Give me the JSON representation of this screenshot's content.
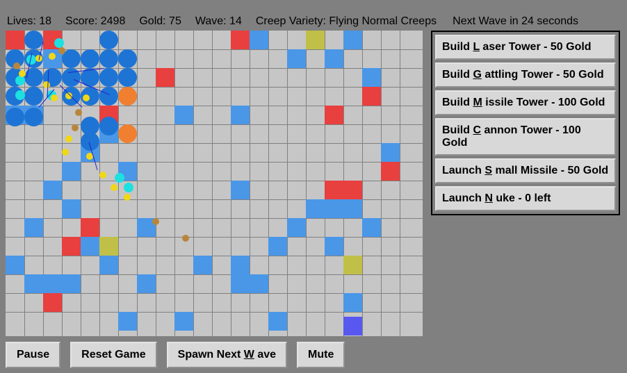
{
  "stats": {
    "lives_label": "Lives:",
    "lives": 18,
    "score_label": "Score:",
    "score": 2498,
    "gold_label": "Gold:",
    "gold": 75,
    "wave_label": "Wave:",
    "wave": 14,
    "creep_variety_label": "Creep Variety:",
    "creep_variety": "Flying Normal Creeps",
    "next_wave_prefix": "Next Wave in",
    "next_wave_seconds": 24,
    "next_wave_suffix": "seconds"
  },
  "build_menu": [
    {
      "pre": "Build ",
      "hot": "L",
      "post": " aser Tower - 50 Gold"
    },
    {
      "pre": "Build ",
      "hot": "G",
      "post": " attling Tower - 50 Gold"
    },
    {
      "pre": "Build ",
      "hot": "M",
      "post": " issile Tower - 100 Gold"
    },
    {
      "pre": "Build ",
      "hot": "C",
      "post": " annon Tower - 100 Gold"
    },
    {
      "pre": "Launch ",
      "hot": "S",
      "post": " mall Missile - 50 Gold"
    },
    {
      "pre": "Launch ",
      "hot": "N",
      "post": " uke - 0 left"
    }
  ],
  "bottom_buttons": {
    "pause": "Pause",
    "reset": "Reset Game",
    "spawn_pre": "Spawn Next ",
    "spawn_hot": "W",
    "spawn_post": " ave",
    "mute": "Mute"
  },
  "grid": {
    "cols": 22,
    "rows": 16,
    "cell": 27
  },
  "colors": {
    "bg": "#808080",
    "board": "#c6c6c6",
    "wall_red": "#e83f3f",
    "tower_blue": "#4a97e8",
    "olive": "#c0c048",
    "exit_purple": "#5858f0",
    "creep_big": "#1e74d4",
    "creep_cyan": "#1de0e0",
    "creep_yellow": "#f0d818",
    "creep_orange": "#f08030",
    "creep_brown": "#b8863b",
    "laser": "#2020d0"
  }
}
